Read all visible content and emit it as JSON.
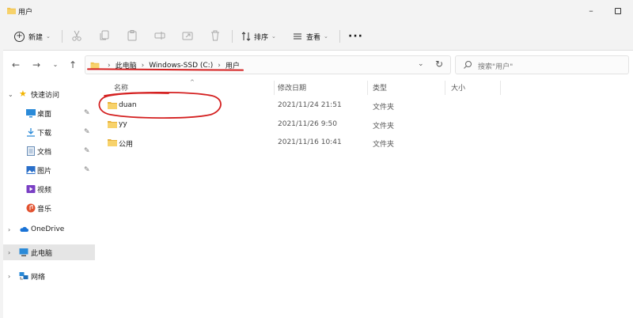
{
  "window": {
    "title": "用户"
  },
  "toolbar": {
    "new_label": "新建",
    "sort_label": "排序",
    "view_label": "查看",
    "more_label": "···"
  },
  "address": {
    "crumbs": [
      "此电脑",
      "Windows-SSD (C:)",
      "用户"
    ],
    "search_placeholder": "搜索\"用户\""
  },
  "sidebar": {
    "quick_access": "快速访问",
    "items": [
      {
        "label": "桌面",
        "icon": "desktop-icon"
      },
      {
        "label": "下载",
        "icon": "download-icon"
      },
      {
        "label": "文档",
        "icon": "document-icon"
      },
      {
        "label": "图片",
        "icon": "picture-icon"
      },
      {
        "label": "视频",
        "icon": "video-icon"
      },
      {
        "label": "音乐",
        "icon": "music-icon"
      }
    ],
    "onedrive": "OneDrive",
    "this_pc": "此电脑",
    "network": "网络"
  },
  "columns": {
    "name": "名称",
    "date": "修改日期",
    "type": "类型",
    "size": "大小"
  },
  "files": [
    {
      "name": "duan",
      "date": "2021/11/24 21:51",
      "type": "文件夹"
    },
    {
      "name": "yy",
      "date": "2021/11/26 9:50",
      "type": "文件夹"
    },
    {
      "name": "公用",
      "date": "2021/11/16 10:41",
      "type": "文件夹"
    }
  ],
  "colors": {
    "folder": "#f0c04a",
    "annotation": "#d42020",
    "selected": "#e5e5e5"
  }
}
